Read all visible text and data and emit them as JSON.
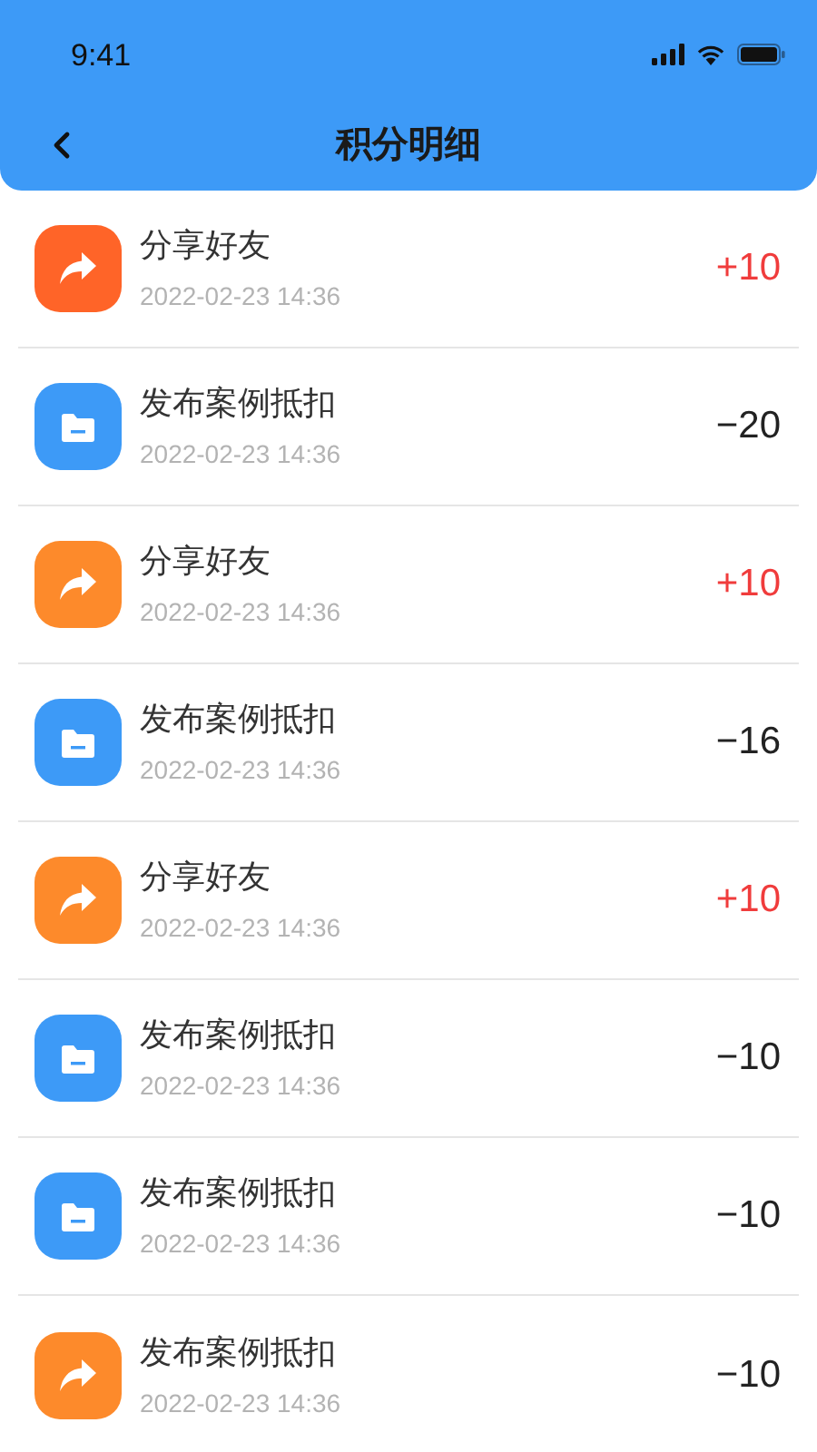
{
  "status_bar": {
    "time": "9:41"
  },
  "nav": {
    "title": "积分明细"
  },
  "records": [
    {
      "kind": "share",
      "color": "#ff6428",
      "title": "分享好友",
      "time": "2022-02-23 14:36",
      "amount": "+10",
      "credit": true
    },
    {
      "kind": "file",
      "color": "#3d9af7",
      "title": "发布案例抵扣",
      "time": "2022-02-23 14:36",
      "amount": "−20",
      "credit": false
    },
    {
      "kind": "share",
      "color": "#fd8a2b",
      "title": "分享好友",
      "time": "2022-02-23 14:36",
      "amount": "+10",
      "credit": true
    },
    {
      "kind": "file",
      "color": "#3d9af7",
      "title": "发布案例抵扣",
      "time": "2022-02-23 14:36",
      "amount": "−16",
      "credit": false
    },
    {
      "kind": "share",
      "color": "#fd8a2b",
      "title": "分享好友",
      "time": "2022-02-23 14:36",
      "amount": "+10",
      "credit": true
    },
    {
      "kind": "file",
      "color": "#3d9af7",
      "title": "发布案例抵扣",
      "time": "2022-02-23 14:36",
      "amount": "−10",
      "credit": false
    },
    {
      "kind": "file",
      "color": "#3d9af7",
      "title": "发布案例抵扣",
      "time": "2022-02-23 14:36",
      "amount": "−10",
      "credit": false
    },
    {
      "kind": "share",
      "color": "#fd8a2b",
      "title": "发布案例抵扣",
      "time": "2022-02-23 14:36",
      "amount": "−10",
      "credit": false
    }
  ]
}
